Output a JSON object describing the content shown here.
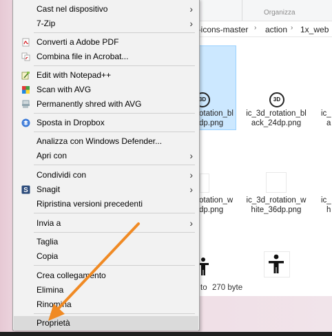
{
  "explorer": {
    "ribbon_section": "Organizza",
    "breadcrumb": [
      "n-icons-master",
      "action",
      "1x_web"
    ],
    "files": [
      {
        "name_line1": "otation_bl",
        "name_line2": "dp.png"
      },
      {
        "name_line1": "ic_3d_rotation_bl",
        "name_line2": "ack_24dp.png"
      },
      {
        "name_line1": "ic_",
        "name_line2": "a"
      },
      {
        "name_line1": "otation_w",
        "name_line2": "dp.png"
      },
      {
        "name_line1": "ic_3d_rotation_w",
        "name_line2": "hite_36dp.png"
      },
      {
        "name_line1": "ic_",
        "name_line2": "h"
      }
    ],
    "icon_3d_text": "3D",
    "status_partial": "to",
    "status_size": "270 byte"
  },
  "menu": {
    "items": [
      {
        "label": "Cast nel dispositivo",
        "submenu": true,
        "icon": ""
      },
      {
        "label": "7-Zip",
        "submenu": true,
        "icon": ""
      },
      {
        "label": "Converti a Adobe PDF",
        "submenu": false,
        "icon": "adobe-pdf-icon"
      },
      {
        "label": "Combina file in Acrobat...",
        "submenu": false,
        "icon": "acrobat-combine-icon"
      },
      {
        "label": "Edit with Notepad++",
        "submenu": false,
        "icon": "notepad-plus-icon"
      },
      {
        "label": "Scan with AVG",
        "submenu": false,
        "icon": "avg-scan-icon"
      },
      {
        "label": "Permanently shred with AVG",
        "submenu": false,
        "icon": "avg-shred-icon"
      },
      {
        "label": "Sposta in Dropbox",
        "submenu": false,
        "icon": "dropbox-icon"
      },
      {
        "label": "Analizza con Windows Defender...",
        "submenu": false,
        "icon": ""
      },
      {
        "label": "Apri con",
        "submenu": true,
        "icon": ""
      },
      {
        "label": "Condividi con",
        "submenu": true,
        "icon": ""
      },
      {
        "label": "Snagit",
        "submenu": true,
        "icon": "snagit-icon"
      },
      {
        "label": "Ripristina versioni precedenti",
        "submenu": false,
        "icon": ""
      },
      {
        "label": "Invia a",
        "submenu": true,
        "icon": ""
      },
      {
        "label": "Taglia",
        "submenu": false,
        "icon": ""
      },
      {
        "label": "Copia",
        "submenu": false,
        "icon": ""
      },
      {
        "label": "Crea collegamento",
        "submenu": false,
        "icon": ""
      },
      {
        "label": "Elimina",
        "submenu": false,
        "icon": ""
      },
      {
        "label": "Rinomina",
        "submenu": false,
        "icon": ""
      },
      {
        "label": "Proprietà",
        "submenu": false,
        "icon": "",
        "highlighted": true
      }
    ]
  },
  "colors": {
    "menu_bg": "#f2f2f2",
    "highlight": "#dadada",
    "annotation_arrow": "#f08a24",
    "selection": "#cce8ff"
  }
}
